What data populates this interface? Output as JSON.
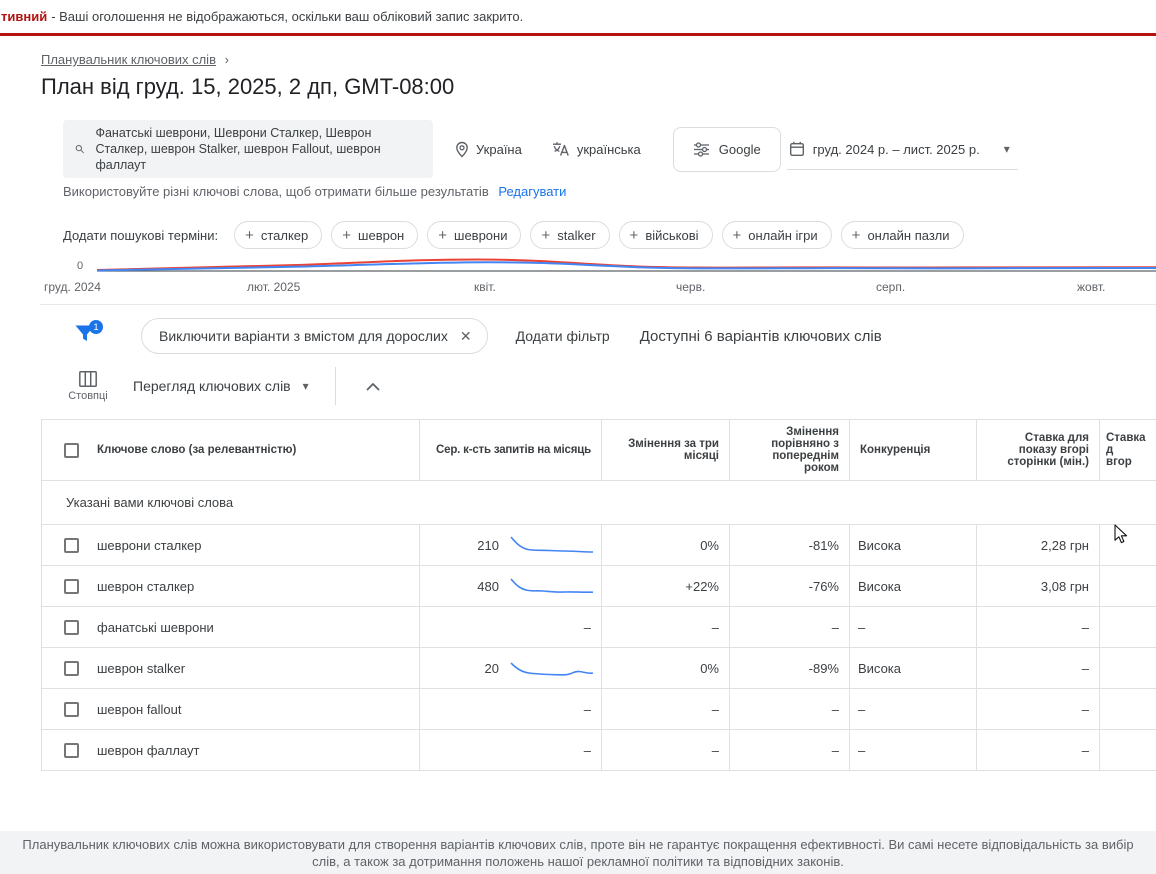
{
  "colors": {
    "accent_blue": "#1a73e8",
    "banner_red": "#b31412",
    "trend_red": "#ea4335",
    "trend_blue": "#4285f4",
    "sparkline_blue": "#4285f4"
  },
  "icons": {
    "plus": "+",
    "close": "✕",
    "caret_down": "▾",
    "breadcrumb_sep": "›"
  },
  "banner": {
    "status_fragment": "тивний",
    "message": "- Ваші оголошення не відображаються, оскільки ваш обліковий запис закрито."
  },
  "header": {
    "breadcrumb": "Планувальник ключових слів",
    "title": "План від груд. 15, 2025, 2 дп, GMT-08:00"
  },
  "plan_settings": {
    "keywords": "Фанатські шеврони, Шеврони Сталкер, Шеврон Сталкер, шеврон Stalker, шеврон Fallout, шеврон фаллаут",
    "keywords_hint": "Використовуйте різні ключові слова, щоб отримати більше результатів",
    "edit_link": "Редагувати",
    "location": "Україна",
    "language": "українська",
    "network": "Google",
    "date_range": "груд. 2024 р. – лист. 2025 р."
  },
  "add_terms": {
    "label": "Додати пошукові терміни:",
    "terms": [
      "сталкер",
      "шеврон",
      "шеврони",
      "stalker",
      "військові",
      "онлайн ігри",
      "онлайн пазли"
    ]
  },
  "chart_data": {
    "type": "line",
    "x_labels": [
      "груд. 2024",
      "лют. 2025",
      "квіт.",
      "черв.",
      "серп.",
      "жовт."
    ],
    "y_tick_label": "0",
    "series": [
      {
        "color": "#ea4335"
      },
      {
        "color": "#4285f4"
      }
    ]
  },
  "filters": {
    "active_count": "1",
    "active_filter": "Виключити варіанти з вмістом для дорослих",
    "add_filter_label": "Додати фільтр",
    "results_summary": "Доступні 6 варіантів ключових слів"
  },
  "view_controls": {
    "columns_label": "Стовпці",
    "view_selector": "Перегляд ключових слів"
  },
  "table": {
    "columns": [
      "Ключове слово (за релевантністю)",
      "Сер. к-сть запитів на місяць",
      "Змінення за три місяці",
      "Змінення порівняно з попереднім роком",
      "Конкуренція",
      "Ставка для показу вгорі сторінки (мін.)",
      "Ставка д\nвгор"
    ],
    "section_label": "Указані вами ключові слова",
    "rows": [
      {
        "keyword": "шеврони сталкер",
        "avg_monthly_searches": "210",
        "three_month_change": "0%",
        "yoy_change": "-81%",
        "competition": "Висока",
        "top_of_page_bid_low": "2,28 грн"
      },
      {
        "keyword": "шеврон сталкер",
        "avg_monthly_searches": "480",
        "three_month_change": "+22%",
        "yoy_change": "-76%",
        "competition": "Висока",
        "top_of_page_bid_low": "3,08 грн"
      },
      {
        "keyword": "фанатські шеврони",
        "avg_monthly_searches": "–",
        "three_month_change": "–",
        "yoy_change": "–",
        "competition": "–",
        "top_of_page_bid_low": "–"
      },
      {
        "keyword": "шеврон stalker",
        "avg_monthly_searches": "20",
        "three_month_change": "0%",
        "yoy_change": "-89%",
        "competition": "Висока",
        "top_of_page_bid_low": "–"
      },
      {
        "keyword": "шеврон fallout",
        "avg_monthly_searches": "–",
        "three_month_change": "–",
        "yoy_change": "–",
        "competition": "–",
        "top_of_page_bid_low": "–"
      },
      {
        "keyword": "шеврон фаллаут",
        "avg_monthly_searches": "–",
        "three_month_change": "–",
        "yoy_change": "–",
        "competition": "–",
        "top_of_page_bid_low": "–"
      }
    ]
  },
  "footer": {
    "line1": "Планувальник ключових слів можна використовувати для створення варіантів ключових слів, проте він не гарантує покращення ефективності. Ви самі несете відповідальність за вибір",
    "line2": "слів, а також за дотримання положень нашої рекламної політики та відповідних законів."
  }
}
